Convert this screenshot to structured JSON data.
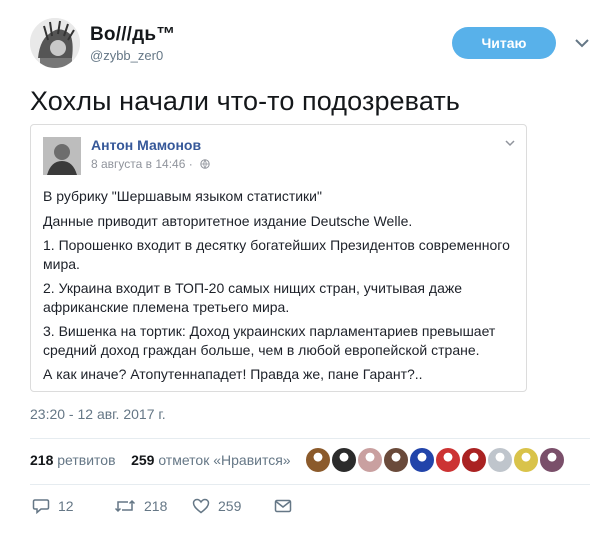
{
  "author": {
    "name": "Bo///дь™",
    "handle": "@zybb_zer0"
  },
  "follow_label": "Читаю",
  "tweet_text": "Хохлы начали что-то подозревать",
  "embed": {
    "author": "Антон Мамонов",
    "date": "8 августа в 14:46 ·",
    "paragraphs": [
      "В рубрику \"Шершавым языком статистики\"",
      "Данные приводит авторитетное издание Deutsche Welle.",
      "1. Порошенко входит в десятку богатейших Президентов современного мира.",
      "2. Украина входит в ТОП-20 самых нищих стран, учитывая даже африканские племена третьего мира.",
      "3. Вишенка на тортик: Доход украинских парламентариев превышает средний доход граждан больше, чем в любой европейской стране.",
      "А как иначе? Атопутеннападет! Правда же, пане Гарант?.."
    ]
  },
  "timestamp": "23:20 - 12 авг. 2017 г.",
  "stats": {
    "retweets_count": "218",
    "retweets_label": "ретвитов",
    "likes_count": "259",
    "likes_label": "отметок «Нравится»"
  },
  "likers": [
    "#8b5a2b",
    "#2b2b2b",
    "#c9a0a0",
    "#6a4a3a",
    "#2244aa",
    "#cc3333",
    "#aa2222",
    "#bfc5cc",
    "#d9c34a",
    "#7a4f6a"
  ],
  "actions": {
    "replies": "12",
    "retweets": "218",
    "likes": "259"
  },
  "colors": {
    "follow_button": "#58b1ea",
    "fb_link": "#365899",
    "muted": "#657786"
  }
}
